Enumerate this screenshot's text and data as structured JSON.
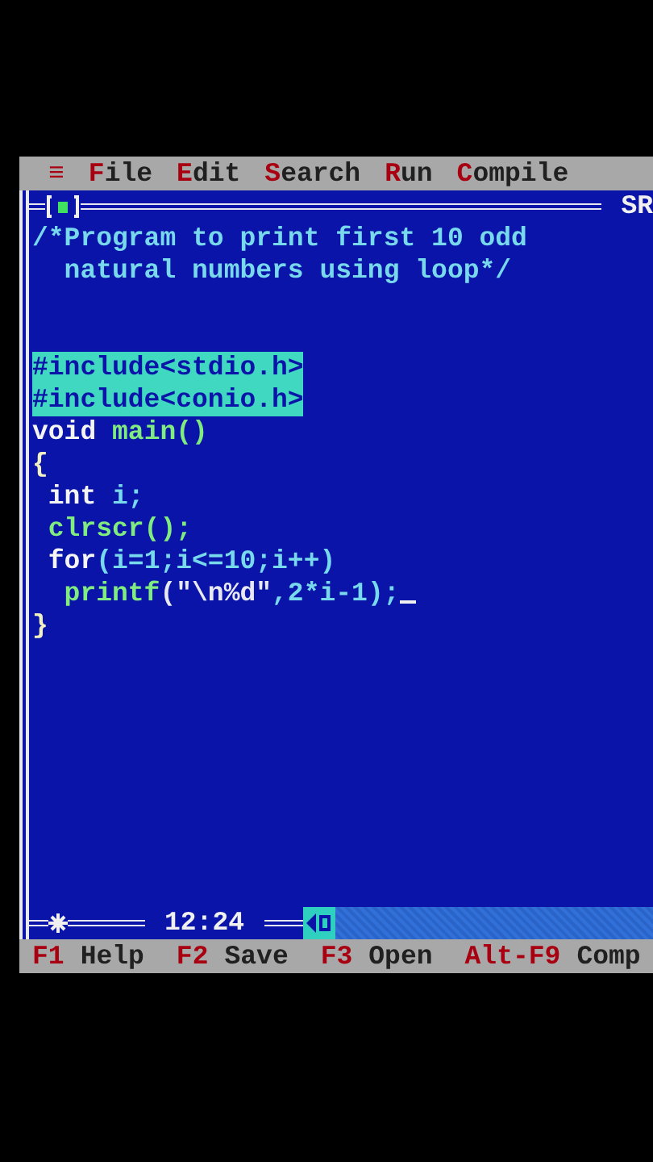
{
  "menu_bar": {
    "items": [
      {
        "label": "≡"
      },
      {
        "label": "File"
      },
      {
        "label": "Edit"
      },
      {
        "label": "Search"
      },
      {
        "label": "Run"
      },
      {
        "label": "Compile"
      }
    ]
  },
  "editor": {
    "title_cut": "SR",
    "lines": [
      {
        "kind": "code",
        "selected": false,
        "cursor": false,
        "tokens": [
          {
            "text": "/*Program to print first 10 odd",
            "kind": "comment"
          }
        ]
      },
      {
        "kind": "code",
        "selected": false,
        "cursor": false,
        "tokens": [
          {
            "text": "  natural numbers using loop*/",
            "kind": "comment"
          }
        ]
      },
      {
        "kind": "blank"
      },
      {
        "kind": "blank"
      },
      {
        "kind": "code",
        "selected": true,
        "cursor": false,
        "tokens": [
          {
            "text": "#include<stdio.h>",
            "kind": "directive"
          }
        ]
      },
      {
        "kind": "code",
        "selected": true,
        "cursor": false,
        "tokens": [
          {
            "text": "#include<conio.h>",
            "kind": "directive"
          }
        ]
      },
      {
        "kind": "code",
        "selected": false,
        "cursor": false,
        "tokens": [
          {
            "text": "void",
            "kind": "keyword"
          },
          {
            "text": " main()",
            "kind": "function"
          }
        ]
      },
      {
        "kind": "code",
        "selected": false,
        "cursor": false,
        "tokens": [
          {
            "text": "{",
            "kind": "punct"
          }
        ]
      },
      {
        "kind": "code",
        "selected": false,
        "cursor": false,
        "tokens": [
          {
            "text": " int",
            "kind": "keyword"
          },
          {
            "text": " i;",
            "kind": "ident"
          }
        ]
      },
      {
        "kind": "code",
        "selected": false,
        "cursor": false,
        "tokens": [
          {
            "text": " clrscr();",
            "kind": "function"
          }
        ]
      },
      {
        "kind": "code",
        "selected": false,
        "cursor": false,
        "tokens": [
          {
            "text": " for",
            "kind": "keyword"
          },
          {
            "text": "(i=1;i<=10;i++)",
            "kind": "ident"
          }
        ]
      },
      {
        "kind": "code",
        "selected": false,
        "cursor": true,
        "tokens": [
          {
            "text": "  printf",
            "kind": "function"
          },
          {
            "text": "(\"\\n%d\"",
            "kind": "string"
          },
          {
            "text": ",2*i-1);",
            "kind": "ident"
          }
        ]
      },
      {
        "kind": "code",
        "selected": false,
        "cursor": false,
        "tokens": [
          {
            "text": "}",
            "kind": "punct"
          }
        ]
      }
    ],
    "position": "12:24"
  },
  "status_bar": {
    "items": [
      {
        "key": "F1",
        "label": "Help"
      },
      {
        "key": "F2",
        "label": "Save"
      },
      {
        "key": "F3",
        "label": "Open"
      },
      {
        "key": "Alt-F9",
        "label": "Comp"
      }
    ]
  }
}
